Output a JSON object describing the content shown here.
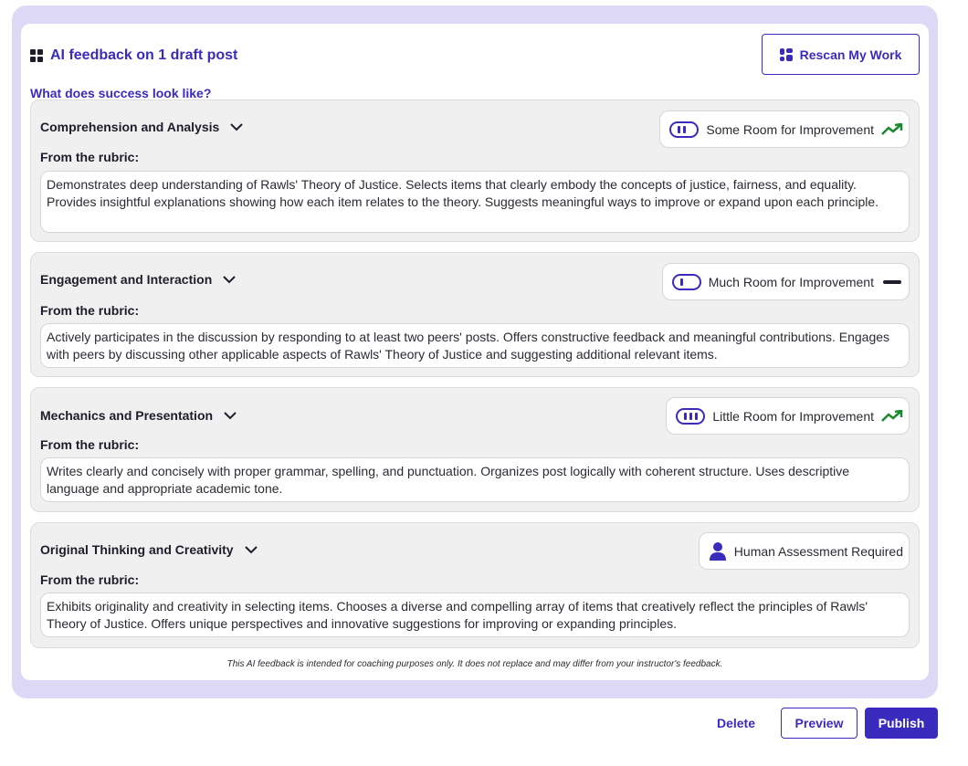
{
  "header": {
    "title": "AI feedback on 1 draft post",
    "rescan_label": "Rescan My Work"
  },
  "success_link": "What does success look like?",
  "rubric_label": "From the rubric:",
  "criteria": [
    {
      "name": "Comprehension and Analysis",
      "status": "Some Room for Improvement",
      "meter_level": "2 of 3",
      "trend": "up",
      "rubric": "Demonstrates deep understanding of Rawls' Theory of Justice. Selects items that clearly embody the concepts of justice, fairness, and equality. Provides insightful explanations showing how each item relates to the theory. Suggests meaningful ways to improve or expand upon each principle."
    },
    {
      "name": "Engagement and Interaction",
      "status": "Much Room for Improvement",
      "meter_level": "1 of 3",
      "trend": "flat",
      "rubric": "Actively participates in the discussion by responding to at least two peers' posts. Offers constructive feedback and meaningful contributions. Engages with peers by discussing other applicable aspects of Rawls' Theory of Justice and suggesting additional relevant items."
    },
    {
      "name": "Mechanics and Presentation",
      "status": "Little Room for Improvement",
      "meter_level": "3 of 3",
      "trend": "up",
      "rubric": "Writes clearly and concisely with proper grammar, spelling, and punctuation. Organizes post logically with coherent structure. Uses descriptive language and appropriate academic tone."
    },
    {
      "name": "Original Thinking and Creativity",
      "status": "Human Assessment Required",
      "rubric": "Exhibits originality and creativity in selecting items. Chooses a diverse and compelling array of items that creatively reflect the principles of Rawls' Theory of Justice. Offers unique perspectives and innovative suggestions for improving or expanding principles."
    }
  ],
  "disclaimer": "This AI feedback is intended for coaching purposes only. It does not replace and may differ from your instructor's feedback.",
  "actions": {
    "delete": "Delete",
    "preview": "Preview",
    "publish": "Publish"
  },
  "colors": {
    "accent": "#3a2bbf",
    "trend_up": "#1a8a2e",
    "frame": "#dcd8f6"
  }
}
